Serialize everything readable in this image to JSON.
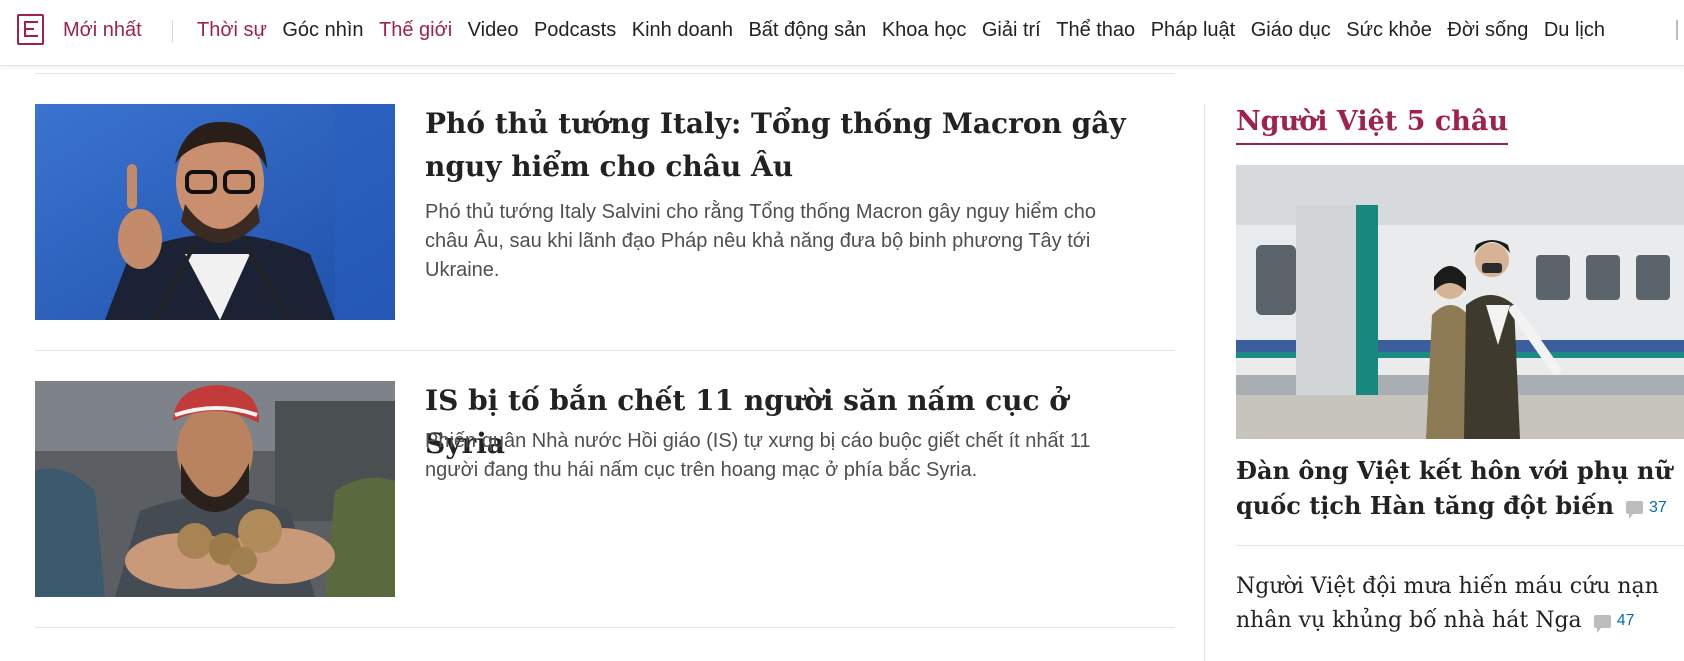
{
  "nav": {
    "newest": "Mới nhất",
    "items": [
      {
        "label": "Thời sự",
        "accent": true
      },
      {
        "label": "Góc nhìn",
        "accent": false
      },
      {
        "label": "Thế giới",
        "accent": true
      },
      {
        "label": "Video",
        "accent": false
      },
      {
        "label": "Podcasts",
        "accent": false
      },
      {
        "label": "Kinh doanh",
        "accent": false
      },
      {
        "label": "Bất động sản",
        "accent": false
      },
      {
        "label": "Khoa học",
        "accent": false
      },
      {
        "label": "Giải trí",
        "accent": false
      },
      {
        "label": "Thể thao",
        "accent": false
      },
      {
        "label": "Pháp luật",
        "accent": false
      },
      {
        "label": "Giáo dục",
        "accent": false
      },
      {
        "label": "Sức khỏe",
        "accent": false
      },
      {
        "label": "Đời sống",
        "accent": false
      },
      {
        "label": "Du lịch",
        "accent": false
      }
    ]
  },
  "articles": [
    {
      "title": "Phó thủ tướng Italy: Tổng thống Macron gây nguy hiểm cho châu Âu",
      "desc": "Phó thủ tướng Italy Salvini cho rằng Tổng thống Macron gây nguy hiểm cho châu Âu, sau khi lãnh đạo Pháp nêu khả năng đưa bộ binh phương Tây tới Ukraine."
    },
    {
      "title": "IS bị tố bắn chết 11 người săn nấm cục ở Syria",
      "desc": "Phiến quân Nhà nước Hồi giáo (IS) tự xưng bị cáo buộc giết chết ít nhất 11 người đang thu hái nấm cục trên hoang mạc ở phía bắc Syria."
    }
  ],
  "sidebar": {
    "heading": "Người Việt 5 châu",
    "main_title": "Đàn ông Việt kết hôn với phụ nữ quốc tịch Hàn tăng đột biến",
    "main_comments": "37",
    "second_title": "Người Việt đội mưa hiến máu cứu nạn nhân vụ khủng bố nhà hát Nga",
    "second_comments": "47"
  },
  "colors": {
    "brand": "#9f224e",
    "comment_link": "#076db6"
  },
  "icons": {
    "logo": "vnexpress-logo",
    "comment": "comment-bubble-icon"
  }
}
